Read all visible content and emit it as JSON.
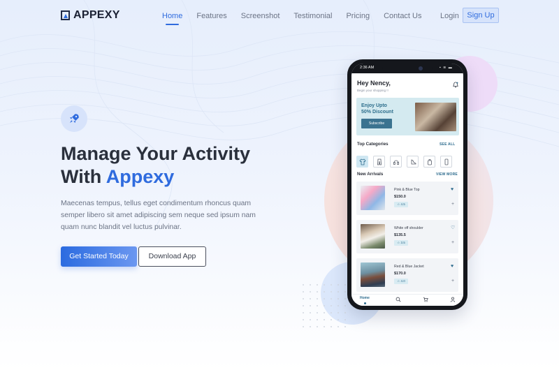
{
  "brand": {
    "name": "APPEXY"
  },
  "nav": {
    "items": [
      {
        "label": "Home"
      },
      {
        "label": "Features"
      },
      {
        "label": "Screenshot"
      },
      {
        "label": "Testimonial"
      },
      {
        "label": "Pricing"
      },
      {
        "label": "Contact Us"
      }
    ],
    "login": "Login",
    "signup": "Sign Up"
  },
  "hero": {
    "headline_line1": "Manage Your Activity",
    "headline_line2_prefix": "With ",
    "headline_accent": "Appexy",
    "paragraph": "Maecenas tempus, tellus eget condimentum rhoncus quam semper libero sit amet adipiscing sem neque sed ipsum nam quam nunc blandit vel luctus pulvinar.",
    "primary_button": "Get Started Today",
    "secondary_button": "Download App"
  },
  "phone": {
    "time": "2:36 AM",
    "greeting": "Hey Nency,",
    "sub_greeting": "Begin your shopping !!",
    "banner": {
      "line1": "Enjoy Upto",
      "line2": "50% Discount",
      "button": "Subscribe"
    },
    "top_categories": {
      "title": "Top Categories",
      "link": "SEE ALL"
    },
    "new_arrivals": {
      "title": "New Arrivals",
      "link": "VIEW MORE"
    },
    "products": [
      {
        "name": "Pink & Blue Top",
        "price": "$150.0",
        "rating": "4.5"
      },
      {
        "name": "White off shoulder",
        "price": "$135.5",
        "rating": "3.5"
      },
      {
        "name": "Red & Blue Jacket",
        "price": "$170.0",
        "rating": "4.0"
      }
    ],
    "bottom_nav": {
      "home": "Home"
    }
  },
  "colors": {
    "accent": "#2f6bde",
    "phone_accent": "#2e6c8e"
  }
}
